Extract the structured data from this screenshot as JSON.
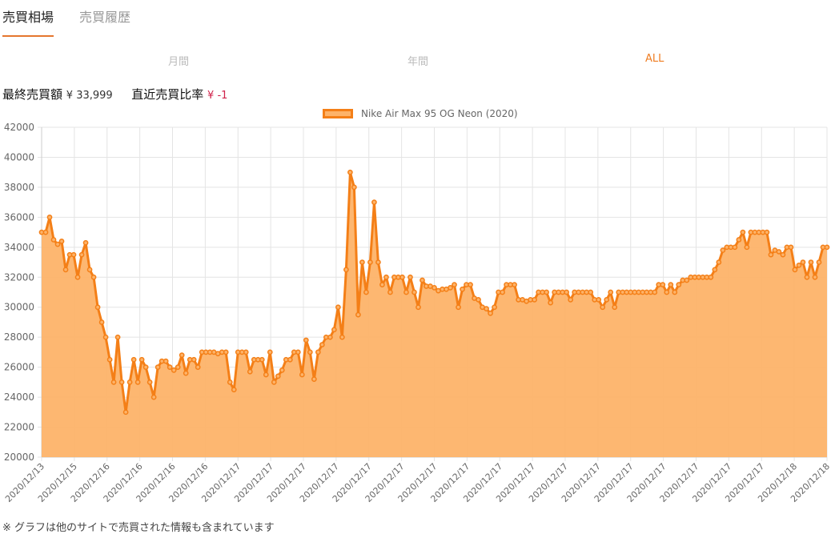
{
  "tabs": [
    {
      "label": "売買相場",
      "active": true
    },
    {
      "label": "売買履歴",
      "active": false
    }
  ],
  "periods": [
    {
      "label": "月間",
      "active": false
    },
    {
      "label": "年間",
      "active": false
    },
    {
      "label": "ALL",
      "active": true
    }
  ],
  "summary": {
    "last_label": "最終売買額",
    "last_value": "¥ 33,999",
    "ratio_label": "直近売買比率",
    "ratio_value": "¥ -1"
  },
  "colors": {
    "accent": "#ef7d22",
    "line": "#f47f17",
    "fill": "#fdb369",
    "negative": "#d0224a"
  },
  "note": "※ グラフは他のサイトで売買された情報も含まれています",
  "chart_data": {
    "type": "area",
    "legend": [
      "Nike Air Max 95 OG Neon (2020)"
    ],
    "ylim": [
      20000,
      42000
    ],
    "yticks": [
      20000,
      22000,
      24000,
      26000,
      28000,
      30000,
      32000,
      34000,
      36000,
      38000,
      40000,
      42000
    ],
    "xtick_labels": [
      "2020/12/13",
      "2020/12/15",
      "2020/12/16",
      "2020/12/16",
      "2020/12/16",
      "2020/12/16",
      "2020/12/17",
      "2020/12/17",
      "2020/12/17",
      "2020/12/17",
      "2020/12/17",
      "2020/12/17",
      "2020/12/17",
      "2020/12/17",
      "2020/12/17",
      "2020/12/17",
      "2020/12/17",
      "2020/12/17",
      "2020/12/17",
      "2020/12/17",
      "2020/12/17",
      "2020/12/17",
      "2020/12/17",
      "2020/12/18",
      "2020/12/18"
    ],
    "grid": true,
    "series": [
      {
        "name": "Nike Air Max 95 OG Neon (2020)",
        "values": [
          35000,
          35000,
          36000,
          34500,
          34200,
          34400,
          32500,
          33500,
          33500,
          32000,
          33500,
          34300,
          32500,
          32000,
          30000,
          29000,
          28000,
          26500,
          25000,
          28000,
          25000,
          23000,
          25000,
          26500,
          25000,
          26500,
          26000,
          25000,
          24000,
          26000,
          26400,
          26400,
          26000,
          25800,
          26000,
          26800,
          25600,
          26500,
          26500,
          26000,
          27000,
          27000,
          27000,
          27000,
          26900,
          27000,
          27000,
          25000,
          24500,
          27000,
          27000,
          27000,
          25700,
          26500,
          26500,
          26500,
          25500,
          27000,
          25000,
          25400,
          25800,
          26500,
          26500,
          27000,
          27000,
          25500,
          27800,
          27000,
          25200,
          27000,
          27500,
          28000,
          28000,
          28500,
          30000,
          28000,
          32500,
          39000,
          38000,
          29500,
          33000,
          31000,
          33000,
          37000,
          33000,
          31500,
          32000,
          31000,
          32000,
          32000,
          32000,
          31000,
          32000,
          31000,
          30000,
          31800,
          31400,
          31400,
          31300,
          31100,
          31200,
          31200,
          31300,
          31500,
          30000,
          31200,
          31500,
          31500,
          30600,
          30500,
          30000,
          29900,
          29600,
          30000,
          31000,
          31000,
          31500,
          31500,
          31500,
          30500,
          30500,
          30400,
          30500,
          30500,
          31000,
          31000,
          31000,
          30300,
          31000,
          31000,
          31000,
          31000,
          30500,
          31000,
          31000,
          31000,
          31000,
          31000,
          30500,
          30500,
          30000,
          30500,
          31000,
          30000,
          31000,
          31000,
          31000,
          31000,
          31000,
          31000,
          31000,
          31000,
          31000,
          31000,
          31500,
          31500,
          31000,
          31500,
          31000,
          31500,
          31800,
          31800,
          32000,
          32000,
          32000,
          32000,
          32000,
          32000,
          32500,
          33000,
          33800,
          34000,
          34000,
          34000,
          34500,
          35000,
          34000,
          35000,
          35000,
          35000,
          35000,
          35000,
          33500,
          33800,
          33700,
          33500,
          34000,
          34000,
          32500,
          32800,
          33000,
          32000,
          33000,
          32000,
          33000,
          34000,
          34000
        ]
      }
    ]
  }
}
